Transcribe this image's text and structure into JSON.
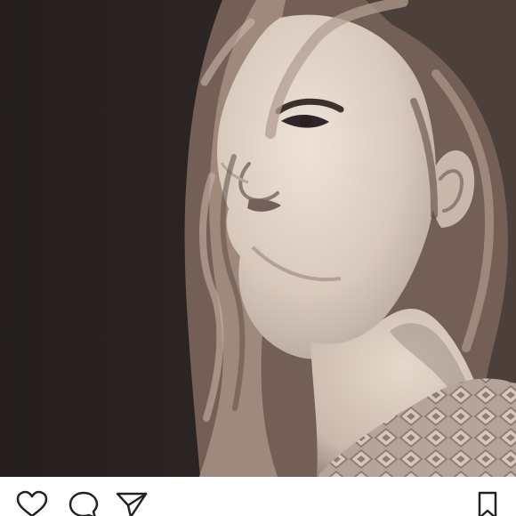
{
  "post": {
    "photo": {
      "subject": "portrait",
      "tone": "sepia",
      "background_color": "#2a2523",
      "skin_color": "#d9cbc0",
      "hair_color": "#9d8779"
    },
    "actions": {
      "like_icon": "heart-outline-icon",
      "comment_icon": "speech-bubble-outline-icon",
      "share_icon": "paper-plane-outline-icon",
      "save_icon": "bookmark-outline-icon",
      "icon_color": "#222222"
    }
  }
}
